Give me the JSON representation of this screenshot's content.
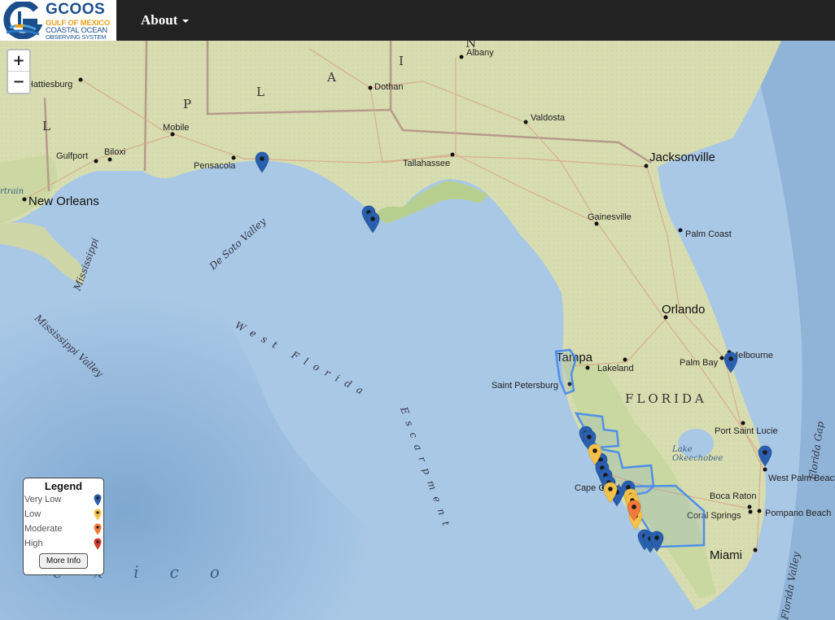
{
  "header": {
    "logo_title": "GCOOS",
    "logo_line1": "GULF OF MEXICO",
    "logo_line2": "COASTAL OCEAN",
    "logo_line3": "OBSERVING SYSTEM",
    "about_label": "About"
  },
  "zoom": {
    "in_label": "+",
    "out_label": "−"
  },
  "map": {
    "cities": [
      "Albany",
      "Hattiesburg",
      "Dothan",
      "Valdosta",
      "Mobile",
      "Gulfport",
      "Biloxi",
      "Pensacola",
      "Tallahassee",
      "Jacksonville",
      "New Orleans",
      "Gainesville",
      "Palm Coast",
      "Orlando",
      "Tampa",
      "Lakeland",
      "Palm Bay",
      "Melbourne",
      "Saint Petersburg",
      "Port Saint Lucie",
      "West Palm Beach",
      "Cape Coral",
      "Boca Raton",
      "Coral Springs",
      "Pompano Beach",
      "Miami"
    ],
    "regions": [
      "FLORIDA",
      "A",
      "L",
      "P",
      "I",
      "N",
      "L"
    ],
    "features": [
      "De Soto Valley",
      "West Florida Escarpment",
      "Mississippi Valley",
      "Mississippi",
      "Florida Gap",
      "Florida Valley",
      "Lake Okeechobee",
      "Chartrain"
    ],
    "sea_label": "e x i c o",
    "colors": {
      "water": "#a9c8e6",
      "deep_water": "#8fb4d8",
      "land": "#d8dfb0",
      "land_green": "#bfd49a",
      "road": "#d9a88a",
      "boundary": "#4f8fe8"
    }
  },
  "legend": {
    "title": "Legend",
    "items": [
      {
        "label": "Very Low",
        "color": "#2a5fad"
      },
      {
        "label": "Low",
        "color": "#f2c14b"
      },
      {
        "label": "Moderate",
        "color": "#ef7b3b"
      },
      {
        "label": "High",
        "color": "#d63b2f"
      }
    ],
    "more_info": "More Info"
  }
}
